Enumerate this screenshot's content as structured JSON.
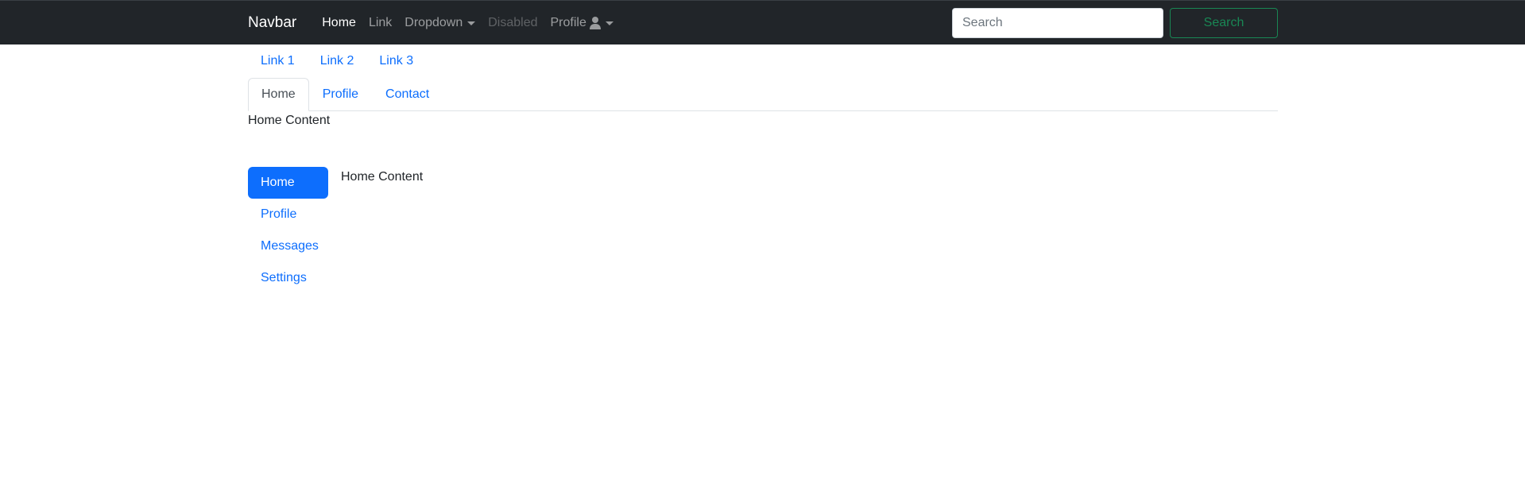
{
  "navbar": {
    "brand": "Navbar",
    "links": [
      {
        "label": "Home",
        "state": "active"
      },
      {
        "label": "Link",
        "state": "normal"
      },
      {
        "label": "Dropdown",
        "state": "normal"
      },
      {
        "label": "Disabled",
        "state": "disabled"
      },
      {
        "label": "Profile",
        "state": "normal"
      }
    ],
    "search": {
      "placeholder": "Search",
      "value": "",
      "button_label": "Search"
    }
  },
  "link_row": {
    "items": [
      "Link 1",
      "Link 2",
      "Link 3"
    ]
  },
  "tabs": {
    "items": [
      "Home",
      "Profile",
      "Contact"
    ],
    "active": "Home",
    "content": "Home Content"
  },
  "vertical_pills": {
    "items": [
      "Home",
      "Profile",
      "Messages",
      "Settings"
    ],
    "active": "Home",
    "content": "Home Content"
  },
  "colors": {
    "navbar_bg": "#212529",
    "primary": "#0d6efd",
    "success": "#198754",
    "border": "#dee2e6"
  },
  "icons": {
    "profile_icon": "user-icon",
    "dropdown_caret": "chevron-down-icon"
  }
}
